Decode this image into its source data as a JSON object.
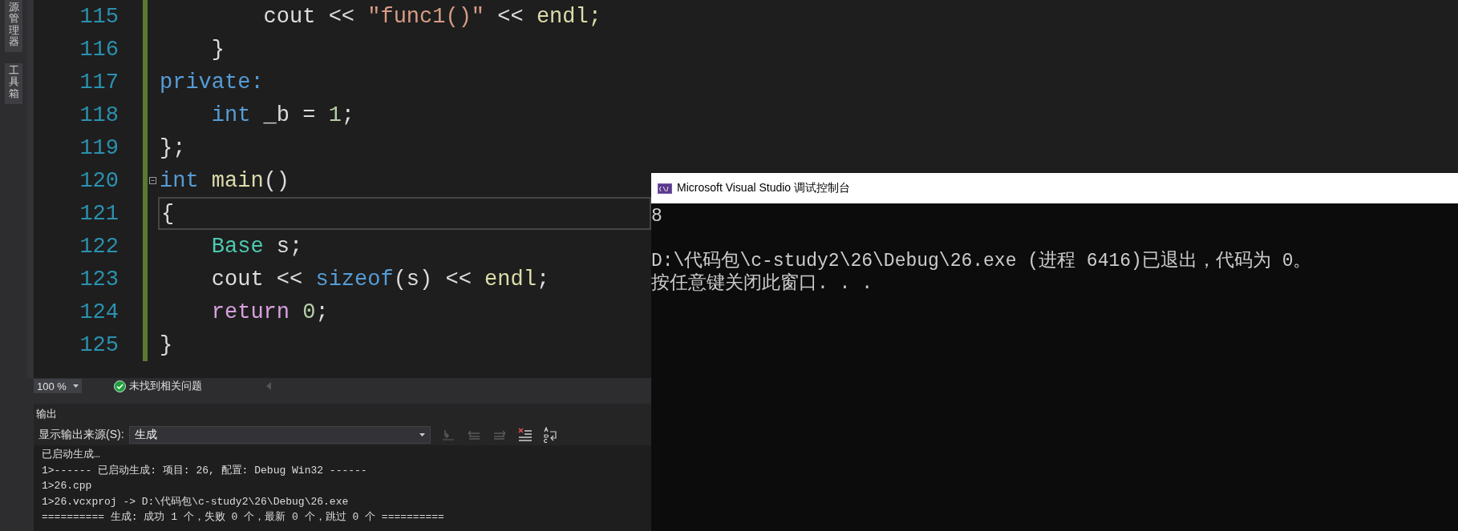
{
  "sidebar": {
    "tabs": [
      {
        "label": "源管理器",
        "selected": false
      },
      {
        "label": "工具箱",
        "selected": false
      }
    ]
  },
  "editor": {
    "lines": [
      {
        "number": "115",
        "changed": true,
        "current": false,
        "fold": false,
        "tokens": [
          {
            "text": "        cout << ",
            "kind": "plain"
          },
          {
            "text": "\"func1()\"",
            "kind": "string"
          },
          {
            "text": " << ",
            "kind": "plain"
          },
          {
            "text": "endl;",
            "kind": "func"
          }
        ]
      },
      {
        "number": "116",
        "changed": true,
        "current": false,
        "fold": false,
        "tokens": [
          {
            "text": "    }",
            "kind": "plain"
          }
        ]
      },
      {
        "number": "117",
        "changed": true,
        "current": false,
        "fold": false,
        "tokens": [
          {
            "text": "private:",
            "kind": "keyword"
          }
        ]
      },
      {
        "number": "118",
        "changed": true,
        "current": false,
        "fold": false,
        "tokens": [
          {
            "text": "    int",
            "kind": "keyword"
          },
          {
            "text": " _b = ",
            "kind": "plain"
          },
          {
            "text": "1",
            "kind": "number"
          },
          {
            "text": ";",
            "kind": "plain"
          }
        ]
      },
      {
        "number": "119",
        "changed": true,
        "current": false,
        "fold": false,
        "tokens": [
          {
            "text": "};",
            "kind": "plain"
          }
        ]
      },
      {
        "number": "120",
        "changed": true,
        "current": false,
        "fold": true,
        "tokens": [
          {
            "text": "int",
            "kind": "keyword"
          },
          {
            "text": " main",
            "kind": "func"
          },
          {
            "text": "()",
            "kind": "plain"
          }
        ]
      },
      {
        "number": "121",
        "changed": true,
        "current": true,
        "fold": false,
        "tokens": [
          {
            "text": "{",
            "kind": "plain"
          }
        ]
      },
      {
        "number": "122",
        "changed": true,
        "current": false,
        "fold": false,
        "tokens": [
          {
            "text": "    Base",
            "kind": "type"
          },
          {
            "text": " s;",
            "kind": "plain"
          }
        ]
      },
      {
        "number": "123",
        "changed": true,
        "current": false,
        "fold": false,
        "tokens": [
          {
            "text": "    cout << ",
            "kind": "plain"
          },
          {
            "text": "sizeof",
            "kind": "keyword"
          },
          {
            "text": "(s) << ",
            "kind": "plain"
          },
          {
            "text": "endl",
            "kind": "func"
          },
          {
            "text": ";",
            "kind": "plain"
          }
        ]
      },
      {
        "number": "124",
        "changed": true,
        "current": false,
        "fold": false,
        "tokens": [
          {
            "text": "    return ",
            "kind": "control"
          },
          {
            "text": "0",
            "kind": "number"
          },
          {
            "text": ";",
            "kind": "plain"
          }
        ]
      },
      {
        "number": "125",
        "changed": true,
        "current": false,
        "fold": false,
        "tokens": [
          {
            "text": "}",
            "kind": "plain"
          }
        ]
      }
    ]
  },
  "status_bar": {
    "zoom": "100 %",
    "issues": "未找到相关问题"
  },
  "output": {
    "title": "输出",
    "source_label": "显示输出来源(S):",
    "source_value": "生成",
    "toolbar": [
      {
        "kind": "goto",
        "disabled": true
      },
      {
        "kind": "prev",
        "disabled": true
      },
      {
        "kind": "next",
        "disabled": true
      },
      {
        "kind": "clear",
        "disabled": false
      },
      {
        "kind": "wrap",
        "disabled": false
      }
    ],
    "lines": [
      "已启动生成…",
      "1>------ 已启动生成: 项目: 26, 配置: Debug Win32 ------",
      "1>26.cpp",
      "1>26.vcxproj -> D:\\代码包\\c-study2\\26\\Debug\\26.exe",
      "========== 生成: 成功 1 个，失败 0 个，最新 0 个，跳过 0 个 =========="
    ]
  },
  "console": {
    "title": "Microsoft Visual Studio 调试控制台",
    "program_output": [
      "8"
    ],
    "exit_message": [
      "D:\\代码包\\c-study2\\26\\Debug\\26.exe (进程 6416)已退出，代码为 0。",
      "按任意键关闭此窗口. . ."
    ]
  }
}
